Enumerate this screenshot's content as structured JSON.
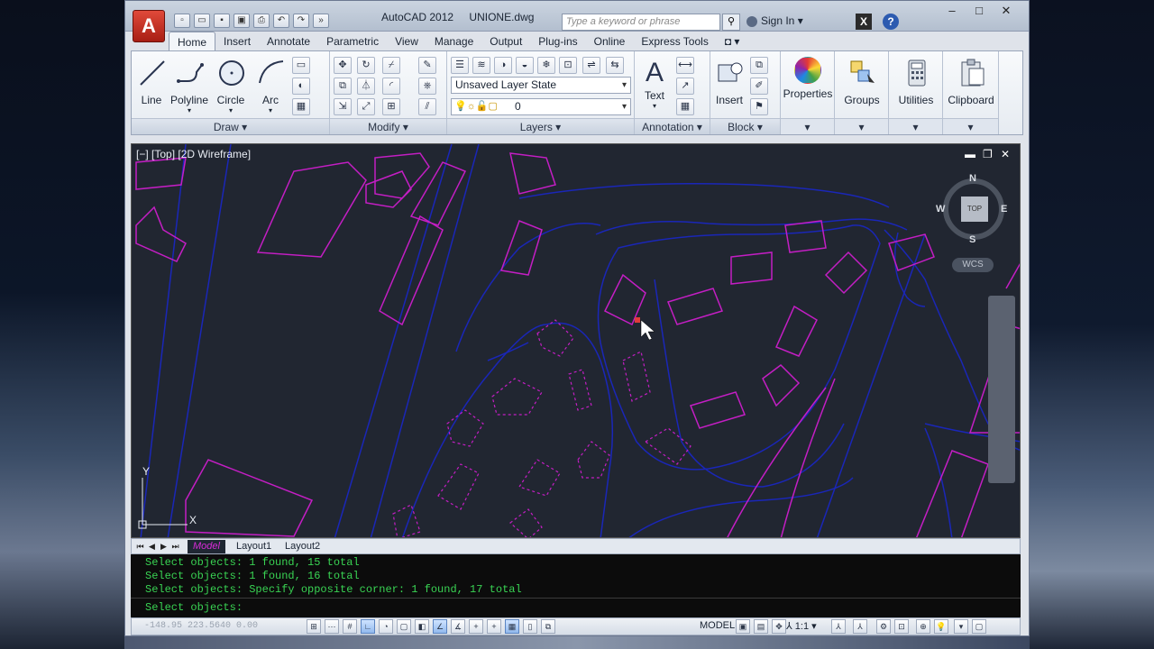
{
  "window": {
    "app_name": "AutoCAD 2012",
    "file_name": "UNIONE.dwg",
    "search_placeholder": "Type a keyword or phrase",
    "sign_in": "Sign In",
    "minimize": "–",
    "maximize": "□",
    "close": "✕"
  },
  "ribbon_tabs": [
    "Home",
    "Insert",
    "Annotate",
    "Parametric",
    "View",
    "Manage",
    "Output",
    "Plug-ins",
    "Online",
    "Express Tools"
  ],
  "panels": {
    "draw": {
      "title": "Draw",
      "tools": [
        "Line",
        "Polyline",
        "Circle",
        "Arc"
      ]
    },
    "modify": {
      "title": "Modify"
    },
    "layers": {
      "title": "Layers",
      "layer_state": "Unsaved Layer State",
      "current_layer": "0"
    },
    "annotation": {
      "title": "Annotation",
      "text_label": "Text"
    },
    "block": {
      "title": "Block",
      "insert_label": "Insert"
    },
    "properties": {
      "label": "Properties"
    },
    "groups": {
      "label": "Groups"
    },
    "utilities": {
      "label": "Utilities"
    },
    "clipboard": {
      "label": "Clipboard"
    }
  },
  "viewport": {
    "label": "[−] [Top] [2D Wireframe]",
    "viewcube": {
      "face": "TOP",
      "north": "N",
      "south": "S",
      "east": "E",
      "west": "W",
      "ucs": "WCS"
    },
    "ucs_x": "X",
    "ucs_y": "Y",
    "colors": {
      "background": "#212631",
      "blue_lines": "#1a26b8",
      "magenta_lines": "#c41ec4",
      "highlight": "#e03b3b"
    }
  },
  "layout_tabs": [
    "Model",
    "Layout1",
    "Layout2"
  ],
  "command_history": [
    "Select objects: 1 found, 15 total",
    "Select objects: 1 found, 16 total",
    "Select objects: Specify opposite corner: 1 found, 17 total"
  ],
  "command_prompt": "Select objects:",
  "status": {
    "model_label": "MODEL",
    "annotation_scale": "1:1",
    "coordinates": "-148.95  223.5640  0.00"
  }
}
